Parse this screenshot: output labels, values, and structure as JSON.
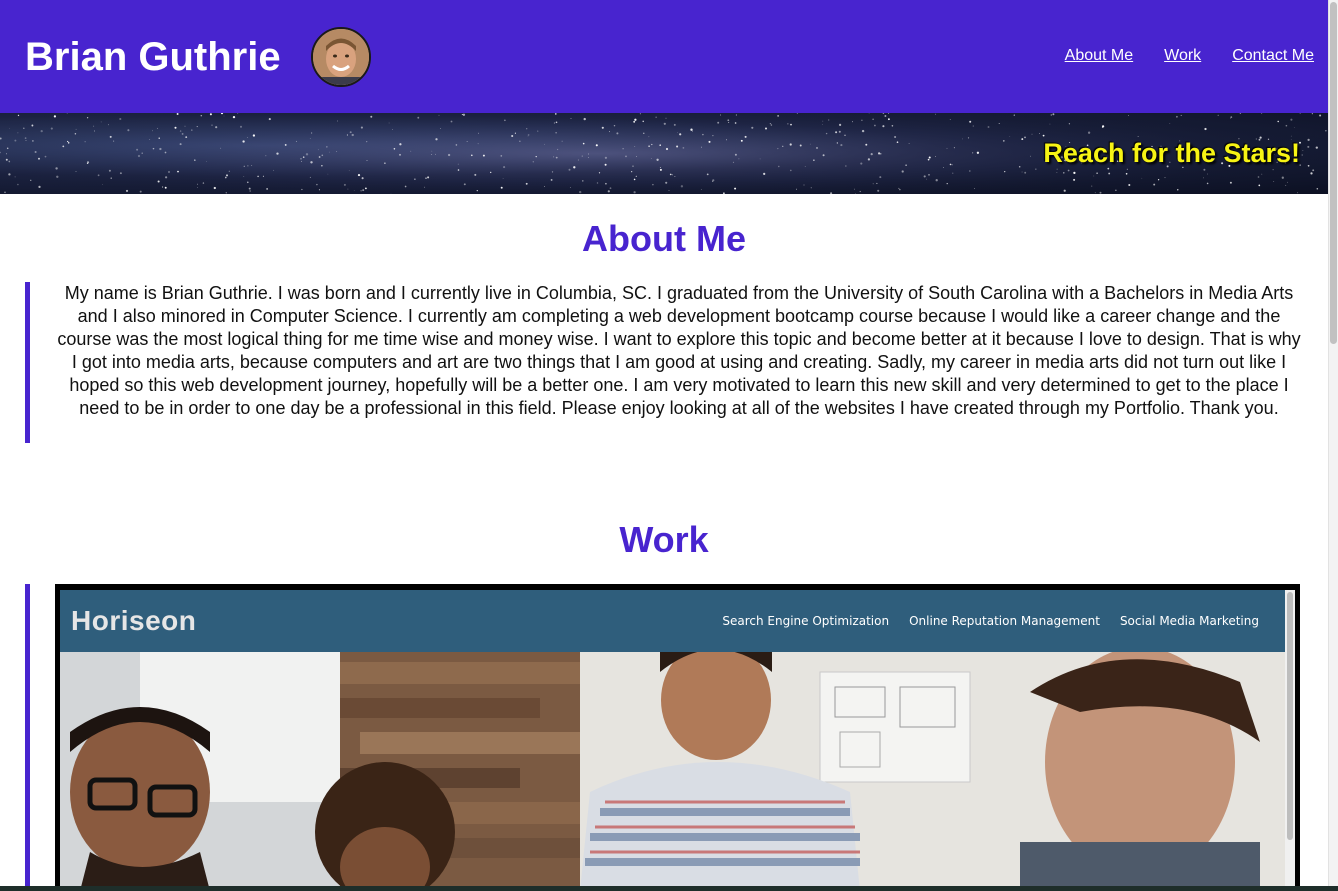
{
  "header": {
    "name": "Brian Guthrie",
    "avatar_icon": "person-avatar-icon",
    "nav": [
      {
        "label": "About Me"
      },
      {
        "label": "Work"
      },
      {
        "label": "Contact Me"
      }
    ]
  },
  "hero": {
    "tagline": "Reach for the Stars!"
  },
  "about": {
    "title": "About Me",
    "body": "My name is Brian Guthrie. I was born and I currently live in Columbia, SC. I graduated from the University of South Carolina with a Bachelors in Media Arts and I also minored in Computer Science. I currently am completing a web development bootcamp course because I would like a career change and the course was the most logical thing for me time wise and money wise. I want to explore this topic and become better at it because I love to design. That is why I got into media arts, because computers and art are two things that I am good at using and creating. Sadly, my career in media arts did not turn out like I hoped so this web development journey, hopefully will be a better one. I am very motivated to learn this new skill and very determined to get to the place I need to be in order to one day be a professional in this field. Please enjoy looking at all of the websites I have created through my Portfolio. Thank you."
  },
  "work": {
    "title": "Work",
    "project": {
      "logo": "Horiseon",
      "nav": [
        {
          "label": "Search Engine Optimization"
        },
        {
          "label": "Online Reputation Management"
        },
        {
          "label": "Social Media Marketing"
        }
      ]
    }
  },
  "colors": {
    "brand_purple": "#4824cf",
    "tagline_yellow": "#f7f414",
    "project_header": "#2f5e7c"
  }
}
